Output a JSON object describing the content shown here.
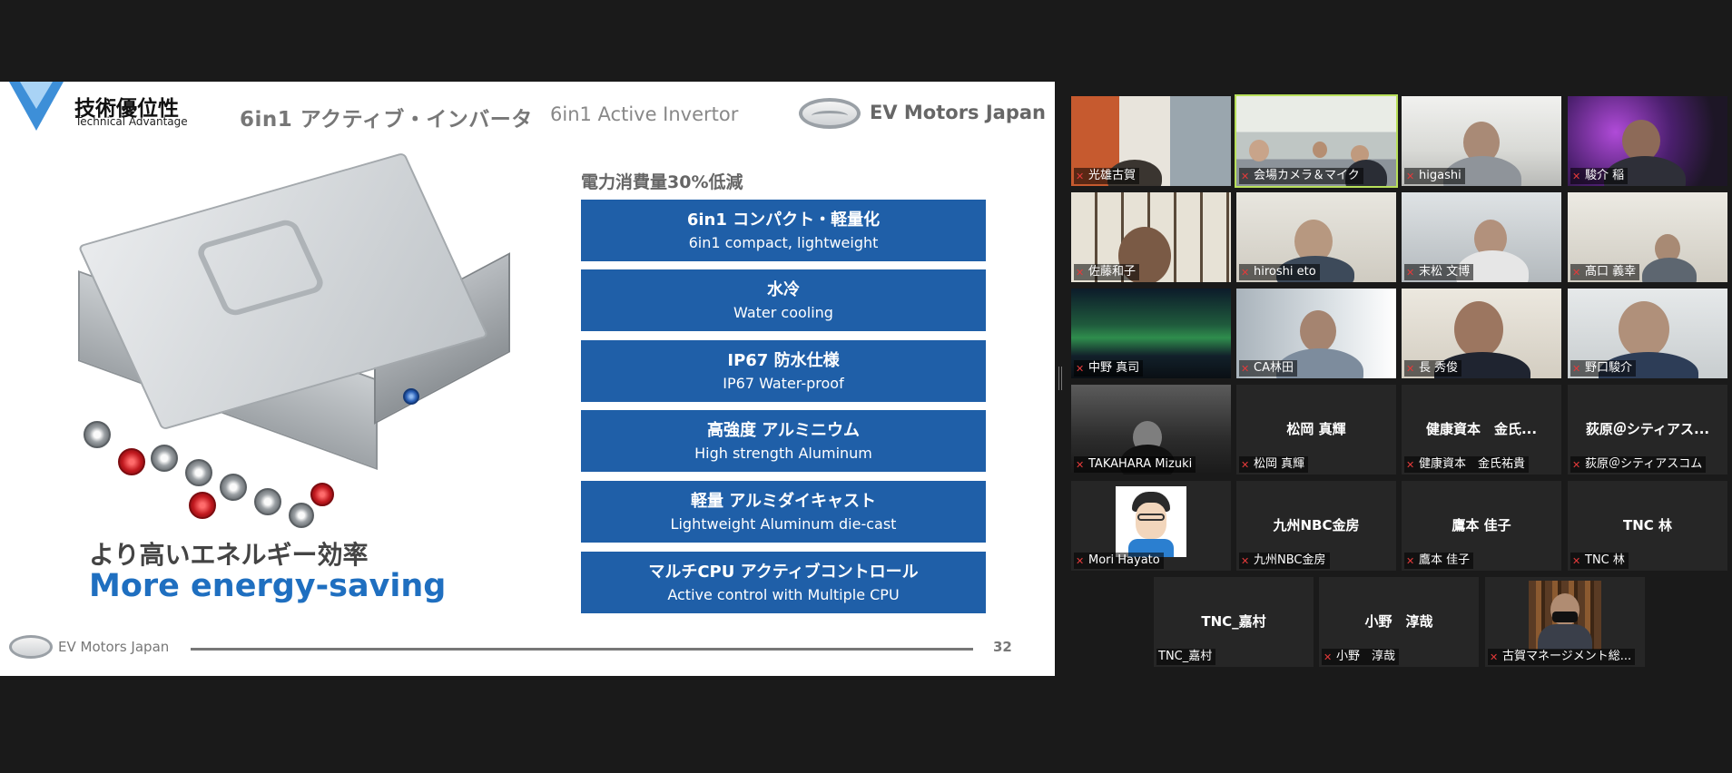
{
  "slide": {
    "section_jp": "技術優位性",
    "section_en": "Technical Advantage",
    "title_jp": "6in1 アクティブ・インバータ",
    "title_en": "6in1 Active Invertor",
    "brand": "EV Motors Japan",
    "power_label": "電力消費量30%低減",
    "features": [
      {
        "jp": "6in1  コンパクト・軽量化",
        "en": "6in1 compact, lightweight"
      },
      {
        "jp": "水冷",
        "en": "Water cooling"
      },
      {
        "jp": "IP67 防水仕様",
        "en": "IP67 Water-proof"
      },
      {
        "jp": "高強度 アルミニウム",
        "en": "High strength Aluminum"
      },
      {
        "jp": "軽量 アルミダイキャスト",
        "en": "Lightweight Aluminum die-cast"
      },
      {
        "jp": "マルチCPU アクティブコントロール",
        "en": "Active control with Multiple CPU"
      }
    ],
    "tagline_jp": "より高いエネルギー効率",
    "tagline_en": "More energy-saving",
    "footer_brand": "EV Motors Japan",
    "page_number": "32",
    "accent_color": "#1f5fa8"
  },
  "gallery": {
    "active_speaker_border": "#b8e05a",
    "participants": [
      {
        "name": "光雄古賀",
        "video": true
      },
      {
        "name": "会場カメラ＆マイク",
        "video": true,
        "active": true
      },
      {
        "name": "higashi",
        "video": true
      },
      {
        "name": "駿介 稲",
        "video": true
      },
      {
        "name": "佐藤和子",
        "video": true
      },
      {
        "name": "hiroshi eto",
        "video": true
      },
      {
        "name": "末松 文博",
        "video": true
      },
      {
        "name": "髙口 義幸",
        "video": true
      },
      {
        "name": "中野 真司",
        "video": true
      },
      {
        "name": "CA林田",
        "video": true
      },
      {
        "name": "長 秀俊",
        "video": true
      },
      {
        "name": "野口駿介",
        "video": true
      },
      {
        "name": "TAKAHARA Mizuki",
        "video": true
      },
      {
        "name": "松岡 真輝",
        "display": "松岡 真輝",
        "video": false
      },
      {
        "name": "健康資本　金氏祐貴",
        "display": "健康資本　金氏...",
        "video": false
      },
      {
        "name": "荻原＠シティアスコム",
        "display": "荻原＠シティアス...",
        "video": false
      },
      {
        "name": "Mori Hayato",
        "video": true
      },
      {
        "name": "九州NBC金房",
        "display": "九州NBC金房",
        "video": false
      },
      {
        "name": "鷹本 佳子",
        "display": "鷹本 佳子",
        "video": false
      },
      {
        "name": "TNC 林",
        "display": "TNC 林",
        "video": false
      },
      {
        "name": "TNC_嘉村",
        "display": "TNC_嘉村",
        "video": false
      },
      {
        "name": "小野　淳哉",
        "display": "小野　淳哉",
        "video": false
      },
      {
        "name": "古賀マネージメント総...",
        "video": true
      }
    ]
  }
}
